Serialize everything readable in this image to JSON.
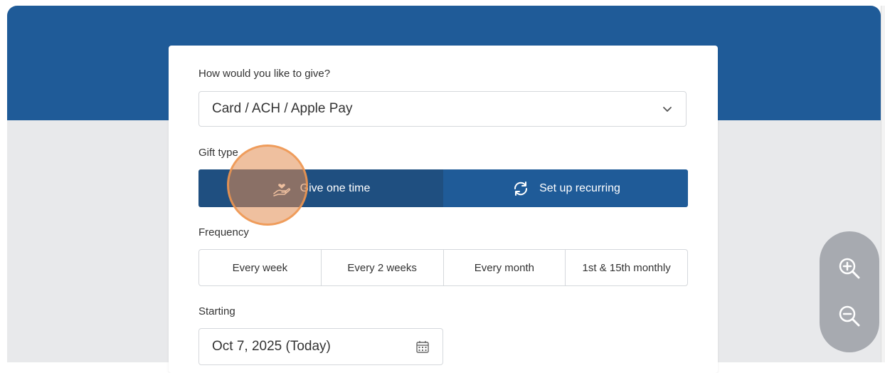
{
  "form": {
    "give_label": "How would you like to give?",
    "method_value": "Card / ACH / Apple Pay",
    "gift_type_label": "Gift type",
    "gift_type_options": [
      {
        "label": "Give one time",
        "icon": "hand-heart-icon",
        "selected": true
      },
      {
        "label": "Set up recurring",
        "icon": "recurring-arrows-icon",
        "selected": false
      }
    ],
    "frequency_label": "Frequency",
    "frequency_options": [
      "Every week",
      "Every 2 weeks",
      "Every month",
      "1st & 15th monthly"
    ],
    "starting_label": "Starting",
    "starting_value": "Oct 7, 2025 (Today)"
  },
  "zoom_controls": {
    "zoom_in_icon": "zoom-in-icon",
    "zoom_out_icon": "zoom-out-icon"
  },
  "colors": {
    "banner": "#1f5b98",
    "segment_active": "#1f4f80",
    "segment_inactive": "#1f5b98",
    "click_highlight": "#e28c50"
  }
}
